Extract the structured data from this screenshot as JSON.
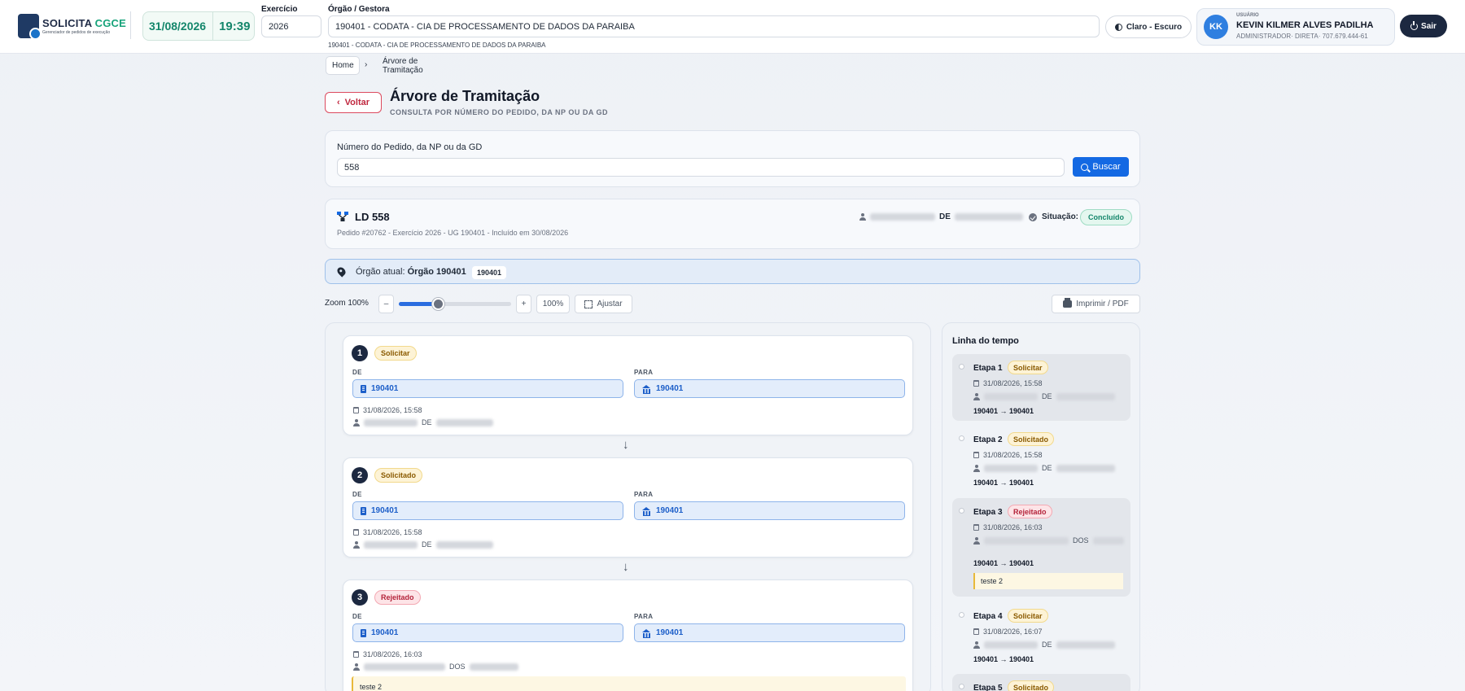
{
  "app": {
    "logo_title_main": "SOLICITA",
    "logo_title_accent": "CGCE",
    "logo_subtitle": "Gerenciador de pedidos de execução",
    "date": "31/08/2026",
    "time": "19:39",
    "exercicio_label": "Exercício",
    "exercicio_value": "2026",
    "orgao_label": "Órgão / Gestora",
    "orgao_value": "190401 - CODATA - CIA DE PROCESSAMENTO DE DADOS DA PARAIBA",
    "orgao_subline": "190401 - CODATA - CIA DE PROCESSAMENTO DE DADOS DA PARAIBA",
    "theme_label": "Claro - Escuro",
    "user_label": "USUÁRIO",
    "user_initials": "KK",
    "user_name": "KEVIN KILMER ALVES PADILHA",
    "user_role": "ADMINISTRADOR· DIRETA· 707.679.444-61",
    "logout_label": "Sair"
  },
  "breadcrumb": {
    "home": "Home",
    "separator": "›",
    "current": "Árvore de Tramitação"
  },
  "page": {
    "back_label": "Voltar",
    "back_icon": "chevron-left-icon",
    "title": "Árvore de Tramitação",
    "subtitle": "CONSULTA POR NÚMERO DO PEDIDO, DA NP OU DA GD"
  },
  "search": {
    "label": "Número do Pedido, da NP ou da GD",
    "value": "558",
    "button_label": "Buscar"
  },
  "summary": {
    "title": "LD 558",
    "meta": "Pedido #20762 - Exercício 2026 - UG 190401 - Incluído em 30/08/2026",
    "from_connector": "DE",
    "status_label": "Situação:",
    "status_value": "Concluído",
    "status_color": "#14866b"
  },
  "orgao_atual": {
    "label": "Órgão atual:",
    "name": "Órgão 190401",
    "code": "190401"
  },
  "zoom": {
    "label": "Zoom 100%",
    "minus": "–",
    "plus": "+",
    "percent": "100%",
    "level": 0.35,
    "fit_label": "Ajustar",
    "print_label": "Imprimir / PDF"
  },
  "steps": [
    {
      "number": "1",
      "status": "Solicitar",
      "de_label": "DE",
      "para_label": "PARA",
      "de": "190401",
      "para": "190401",
      "datetime": "31/08/2026, 15:58",
      "connector": "DE"
    },
    {
      "number": "2",
      "status": "Solicitado",
      "de_label": "DE",
      "para_label": "PARA",
      "de": "190401",
      "para": "190401",
      "datetime": "31/08/2026, 15:58",
      "connector": "DE"
    },
    {
      "number": "3",
      "status": "Rejeitado",
      "de_label": "DE",
      "para_label": "PARA",
      "de": "190401",
      "para": "190401",
      "datetime": "31/08/2026, 16:03",
      "connector": "DOS",
      "note": "teste 2"
    }
  ],
  "timeline": {
    "title": "Linha do tempo",
    "items": [
      {
        "etapa": "Etapa 1",
        "status": "Solicitar",
        "datetime": "31/08/2026, 15:58",
        "connector": "DE",
        "route": "190401 → 190401"
      },
      {
        "etapa": "Etapa 2",
        "status": "Solicitado",
        "datetime": "31/08/2026, 15:58",
        "connector": "DE",
        "route": "190401 → 190401"
      },
      {
        "etapa": "Etapa 3",
        "status": "Rejeitado",
        "datetime": "31/08/2026, 16:03",
        "connector": "DOS",
        "route": "190401 → 190401",
        "note": "teste 2"
      },
      {
        "etapa": "Etapa 4",
        "status": "Solicitar",
        "datetime": "31/08/2026, 16:07",
        "connector": "DE",
        "route": "190401 → 190401"
      },
      {
        "etapa": "Etapa 5",
        "status": "Solicitado"
      }
    ]
  },
  "colors": {
    "accent": "#1469e3",
    "brand_dark": "#1c2840",
    "success": "#14866b",
    "danger": "#c0283f"
  }
}
